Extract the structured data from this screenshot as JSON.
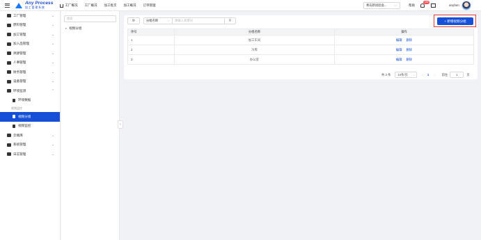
{
  "app": {
    "logo_name": "Any Process",
    "logo_sub": "加工管理系统"
  },
  "topnav": [
    "工厂概况",
    "工厂概况",
    "加工批次",
    "加工概况",
    "订单管理"
  ],
  "header": {
    "factory_select": "青岛新试验会...",
    "help": "帮助",
    "badge": "155",
    "username": "anyfam"
  },
  "sidebar": {
    "items": [
      {
        "label": "工厂管理"
      },
      {
        "label": "原料管理"
      },
      {
        "label": "加工管理"
      },
      {
        "label": "加入品管理"
      },
      {
        "label": "溯源管理"
      },
      {
        "label": "人事管理"
      },
      {
        "label": "财务管理"
      },
      {
        "label": "设备管理"
      },
      {
        "label": "环境监测"
      }
    ],
    "env_sub": "环境数据",
    "group_label": "视频监控",
    "video_group": "视频分组",
    "video_monitor": "视频监控",
    "bottom_items": [
      {
        "label": "云端库"
      },
      {
        "label": "系统管理"
      },
      {
        "label": "日志管理"
      }
    ]
  },
  "tree": {
    "search_placeholder": "搜索",
    "node": "视频分组"
  },
  "toolbar": {
    "field": "分组名称",
    "search_placeholder": "请输入关键词",
    "add_button": "+ 新增视频分组"
  },
  "table": {
    "headers": [
      "序号",
      "分组名称",
      "操作"
    ],
    "rows": [
      {
        "index": "1",
        "name": "加工车间",
        "edit": "编辑",
        "delete": "删除"
      },
      {
        "index": "2",
        "name": "冷库",
        "edit": "编辑",
        "delete": "删除"
      },
      {
        "index": "3",
        "name": "办公室",
        "edit": "编辑",
        "delete": "删除"
      }
    ]
  },
  "pager": {
    "total": "共 3 条",
    "page_size": "10条/页",
    "current": "1",
    "goto_label": "前往",
    "goto_value": "1",
    "unit": "页"
  },
  "colors": {
    "primary": "#1650d8",
    "highlight_border": "#e53935",
    "badge": "#ff4d4f"
  }
}
